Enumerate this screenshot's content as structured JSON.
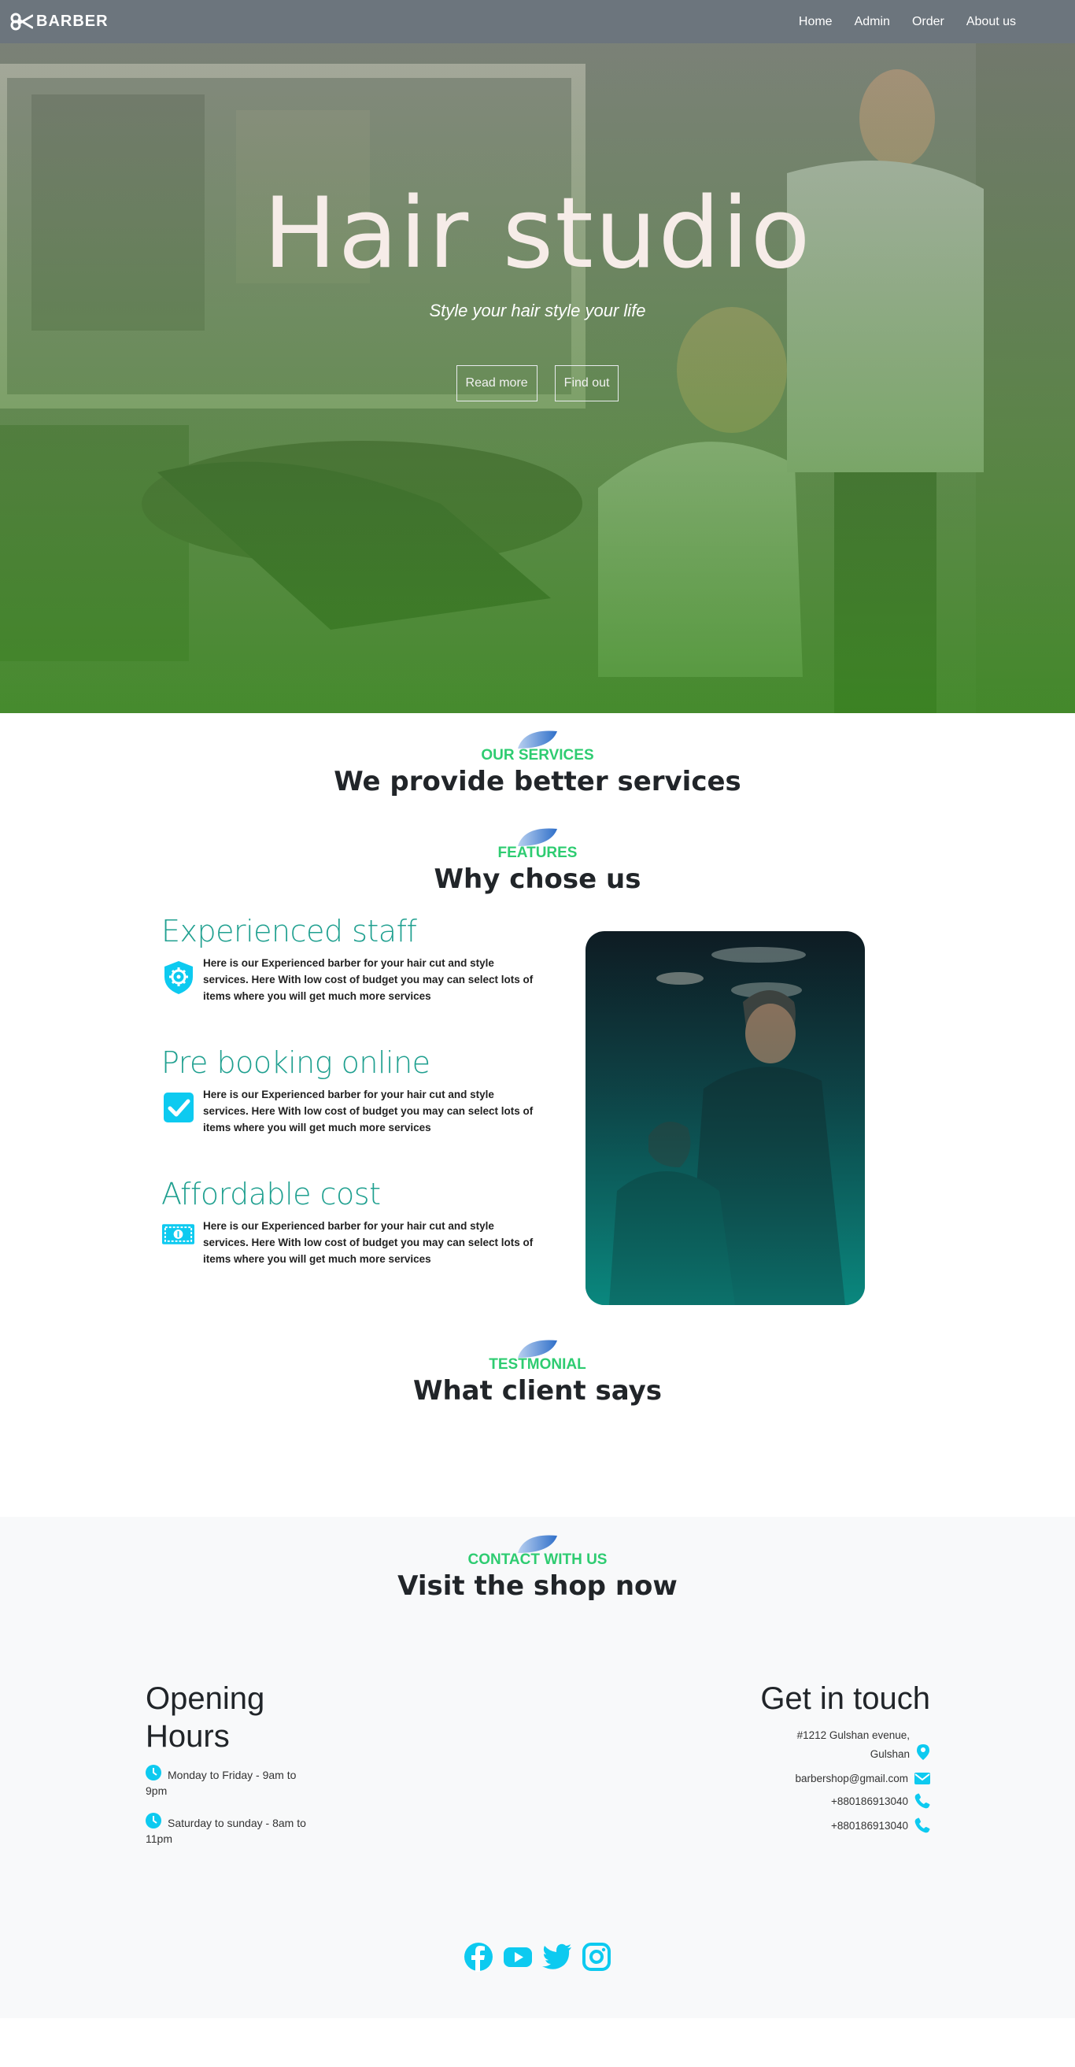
{
  "nav": {
    "brand": "BARBER",
    "links": [
      "Home",
      "Admin",
      "Order",
      "About us"
    ]
  },
  "hero": {
    "title": "Hair studio",
    "subtitle": "Style your hair style your life",
    "buttons": [
      "Read more",
      "Find out"
    ]
  },
  "services": {
    "kicker": "OUR SERVICES",
    "title": "We provide better services"
  },
  "features_head": {
    "kicker": "FEATURES",
    "title": "Why chose us"
  },
  "features": [
    {
      "title": "Experienced staff",
      "text": "Here is our Experienced barber for your hair cut and style services. Here With low cost of budget you may can select lots of items where you will get much more services",
      "icon": "shield-gear-icon"
    },
    {
      "title": "Pre booking online",
      "text": "Here is our Experienced barber for your hair cut and style services. Here With low cost of budget you may can select lots of items where you will get much more services",
      "icon": "check-square-icon"
    },
    {
      "title": "Affordable cost",
      "text": "Here is our Experienced barber for your hair cut and style services. Here With low cost of budget you may can select lots of items where you will get much more services",
      "icon": "money-icon"
    }
  ],
  "testimonial_head": {
    "kicker": "TESTMONIAL",
    "title": "What client says"
  },
  "contact_head": {
    "kicker": "CONTACT WITH US",
    "title": "Visit the shop now"
  },
  "hours": {
    "title": "Opening Hours",
    "items": [
      "Monday to Friday - 9am to 9pm",
      "Saturday to sunday - 8am to 11pm"
    ]
  },
  "get_in_touch": {
    "title": "Get in touch",
    "address": [
      "#1212 Gulshan evenue,",
      "Gulshan"
    ],
    "email": "barbershop@gmail.com",
    "phones": [
      "+880186913040",
      "+880186913040"
    ]
  },
  "social": [
    "facebook-icon",
    "youtube-icon",
    "twitter-icon",
    "instagram-icon"
  ],
  "colors": {
    "accent": "#0dcaf0",
    "green": "#2ecc71",
    "teal": "#20a090",
    "navbar": "#6c757d"
  }
}
